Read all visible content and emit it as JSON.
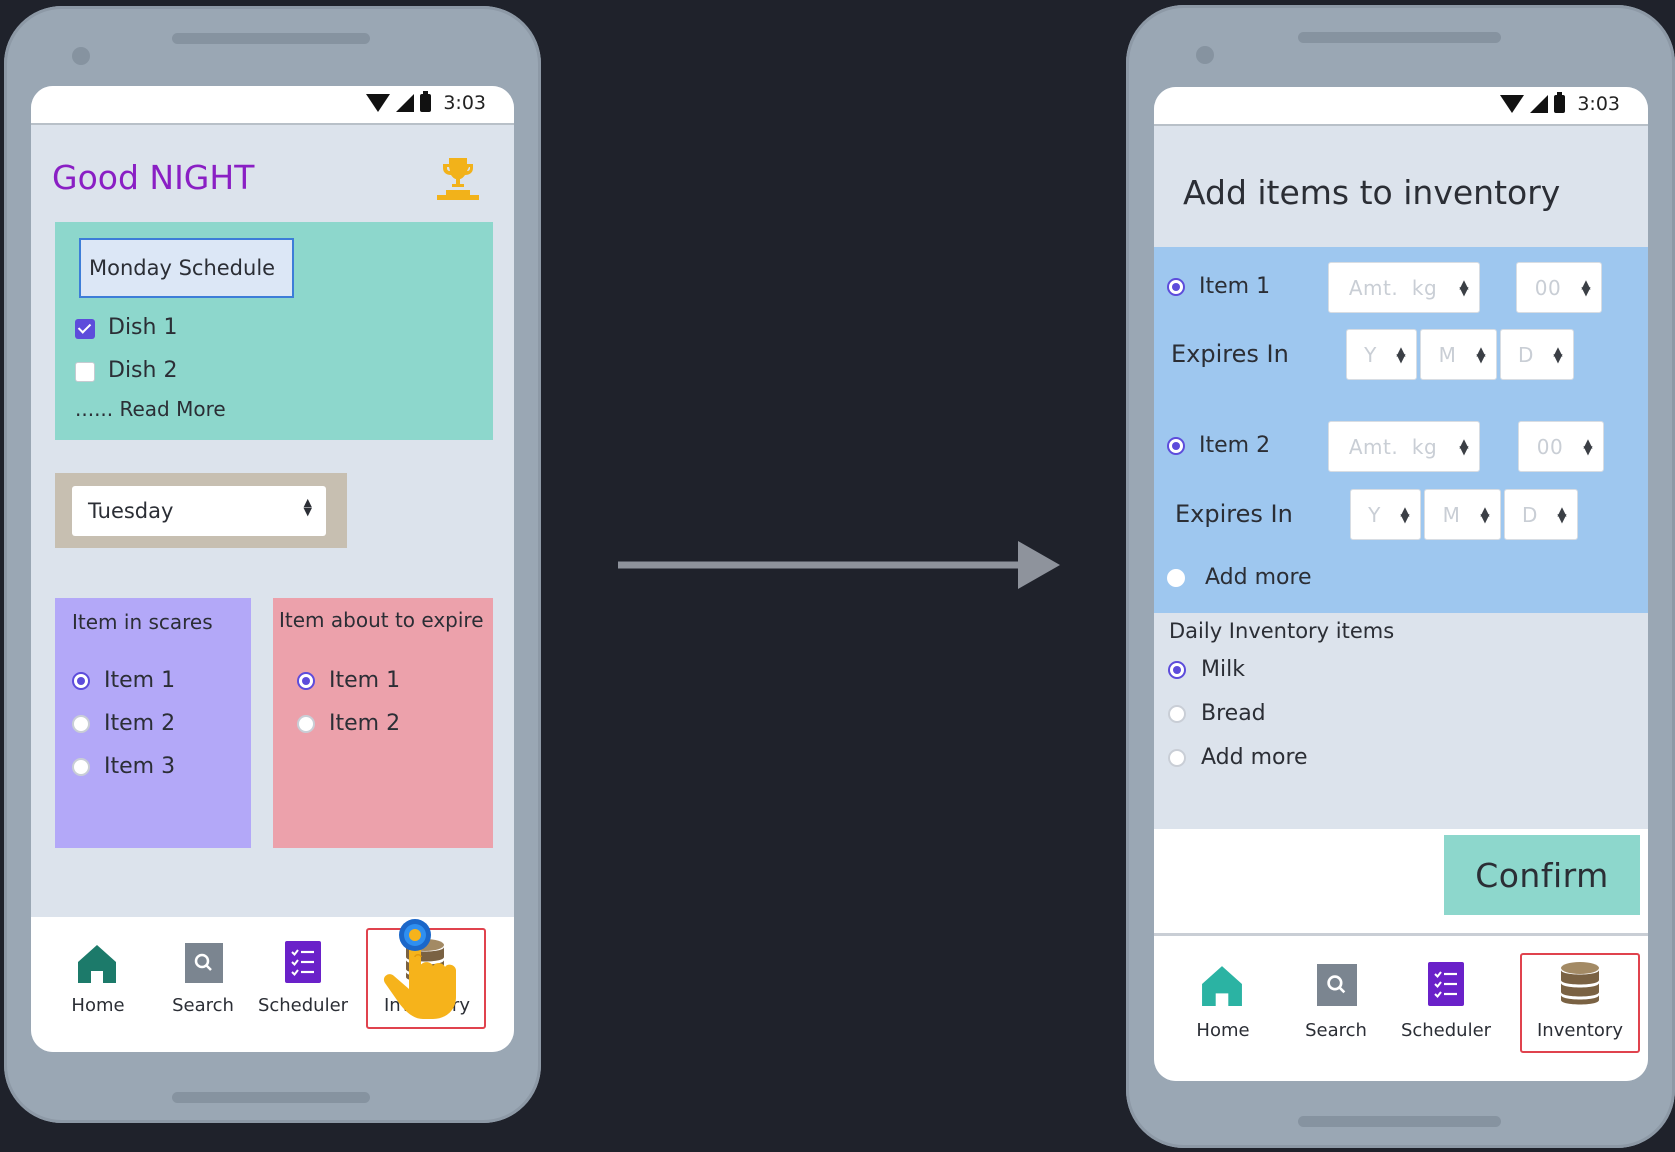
{
  "left_screen": {
    "status_time": "3:03",
    "greeting": "Good NIGHT",
    "trophy_icon": "trophy-icon",
    "schedule_card": {
      "title": "Monday Schedule",
      "dishes": [
        {
          "label": "Dish 1",
          "checked": true
        },
        {
          "label": "Dish 2",
          "checked": false
        }
      ],
      "read_more": "...... Read More"
    },
    "day_select": {
      "value": "Tuesday"
    },
    "scarce_card": {
      "title": "Item in scares",
      "items": [
        {
          "label": "Item 1",
          "selected": true
        },
        {
          "label": "Item 2",
          "selected": false
        },
        {
          "label": "Item 3",
          "selected": false
        }
      ]
    },
    "expire_card": {
      "title": "Item about to expire",
      "items": [
        {
          "label": "Item 1",
          "selected": true
        },
        {
          "label": "Item 2",
          "selected": false
        }
      ]
    },
    "nav": {
      "home": "Home",
      "search": "Search",
      "scheduler": "Scheduler",
      "inventory": "Inventory"
    }
  },
  "right_screen": {
    "status_time": "3:03",
    "title": "Add items to inventory",
    "items": [
      {
        "label": "Item 1",
        "selected": true,
        "amount_placeholder": "Amt.",
        "unit_placeholder": "kg",
        "decimal_placeholder": "00",
        "expires_label": "Expires In",
        "year_placeholder": "Y",
        "month_placeholder": "M",
        "day_placeholder": "D"
      },
      {
        "label": "Item 2",
        "selected": true,
        "amount_placeholder": "Amt.",
        "unit_placeholder": "kg",
        "decimal_placeholder": "00",
        "expires_label": "Expires In",
        "year_placeholder": "Y",
        "month_placeholder": "M",
        "day_placeholder": "D"
      }
    ],
    "add_more": "Add more",
    "daily": {
      "title": "Daily Inventory items",
      "items": [
        {
          "label": "Milk",
          "selected": true
        },
        {
          "label": "Bread",
          "selected": false
        },
        {
          "label": "Add more",
          "selected": false
        }
      ]
    },
    "confirm": "Confirm",
    "nav": {
      "home": "Home",
      "search": "Search",
      "scheduler": "Scheduler",
      "inventory": "Inventory"
    }
  },
  "colors": {
    "background": "#1f222b",
    "greeting": "#8a1fc4",
    "teal_card": "#8dd7cc",
    "purple_card": "#b3a8f8",
    "pink_card": "#eca1ab",
    "blue_panel": "#9ec7ef",
    "confirm": "#8dd7cc",
    "highlight": "#e0434e",
    "radio_accent": "#5d4cdb"
  }
}
